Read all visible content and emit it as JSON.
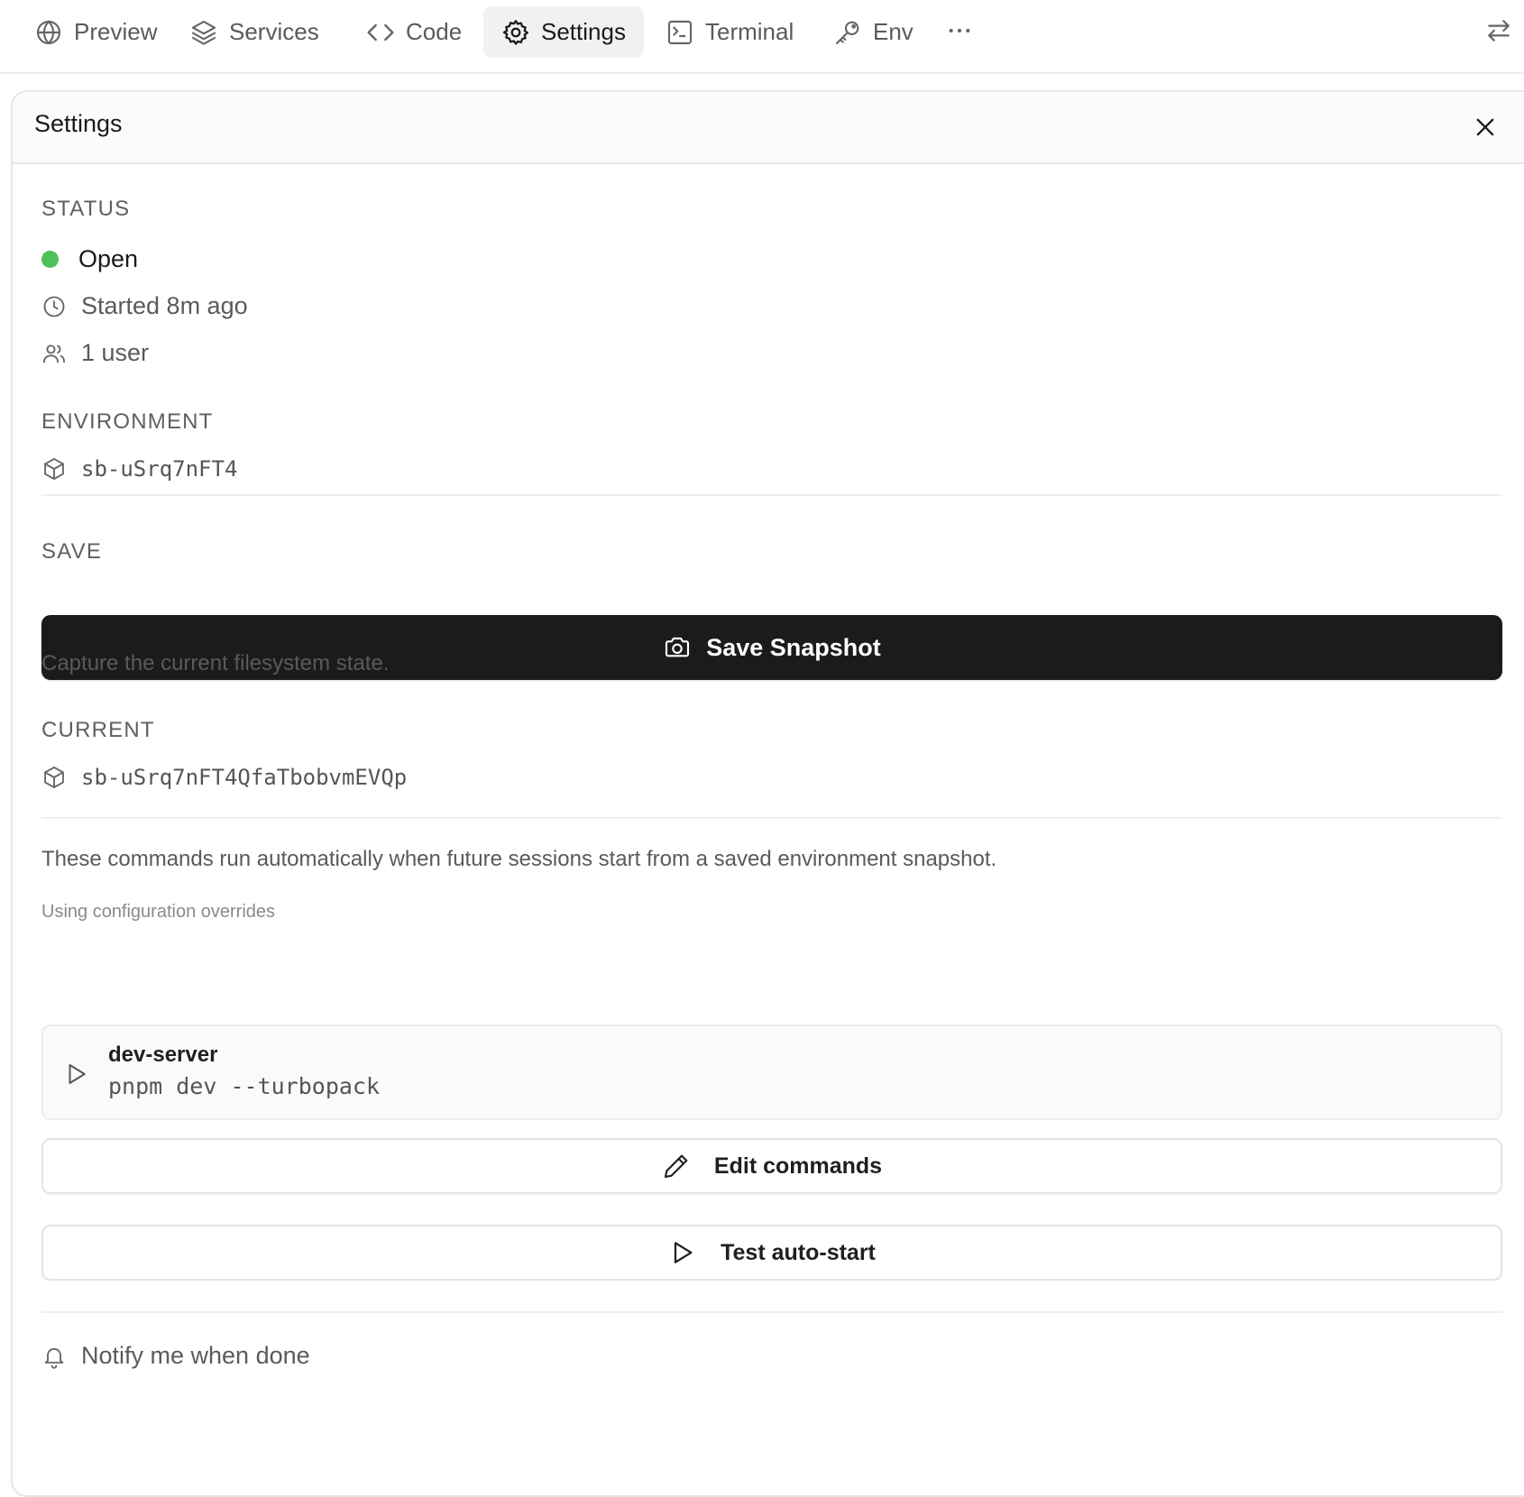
{
  "tabs": [
    {
      "label": "Preview",
      "icon": "globe-icon",
      "active": false
    },
    {
      "label": "Services",
      "icon": "layers-icon",
      "active": false
    },
    {
      "label": "Code",
      "icon": "code-icon",
      "active": false
    },
    {
      "label": "Settings",
      "icon": "gear-icon",
      "active": true
    },
    {
      "label": "Terminal",
      "icon": "terminal-icon",
      "active": false
    },
    {
      "label": "Env",
      "icon": "key-icon",
      "active": false
    }
  ],
  "toolbar": {
    "more_icon": "more-horizontal-icon",
    "swap_icon": "swap-arrows-icon"
  },
  "panel": {
    "title": "Settings",
    "close_icon": "close-icon"
  },
  "status": {
    "heading": "STATUS",
    "state": "Open",
    "state_color": "#4cc25a",
    "started": "Started 8m ago",
    "users": "1 user"
  },
  "environment": {
    "heading": "ENVIRONMENT",
    "id": "sb-uSrq7nFT4"
  },
  "save": {
    "heading": "SAVE",
    "button_label": "Save Snapshot",
    "button_color": "#1b1b1b",
    "description": "Capture the current filesystem state."
  },
  "current": {
    "heading": "CURRENT",
    "snapshot_id": "sb-uSrq7nFT4QfaTbobvmEVQp"
  },
  "autostart": {
    "description": "These commands run automatically when future sessions start from a saved environment snapshot.",
    "note": "Using configuration overrides",
    "commands": [
      {
        "name": "dev-server",
        "command": "pnpm dev --turbopack"
      }
    ],
    "edit_label": "Edit commands",
    "test_label": "Test auto-start"
  },
  "notify": {
    "label": "Notify me when done"
  }
}
